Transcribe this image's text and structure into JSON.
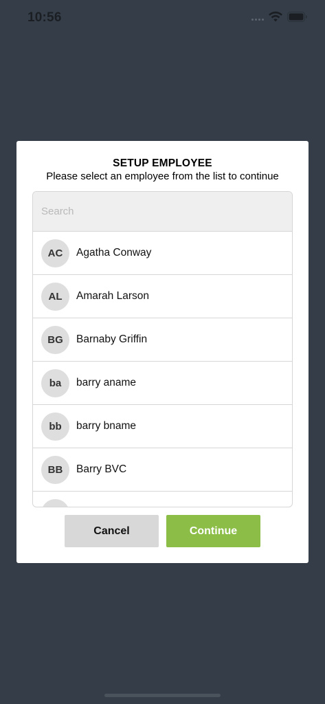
{
  "status_bar": {
    "time": "10:56"
  },
  "dialog": {
    "title": "SETUP EMPLOYEE",
    "subtitle": "Please select an employee from the list to continue",
    "search": {
      "placeholder": "Search",
      "value": ""
    },
    "employees": [
      {
        "initials": "AC",
        "name": "Agatha Conway"
      },
      {
        "initials": "AL",
        "name": "Amarah Larson"
      },
      {
        "initials": "BG",
        "name": "Barnaby Griffin"
      },
      {
        "initials": "ba",
        "name": "barry aname"
      },
      {
        "initials": "bb",
        "name": "barry bname"
      },
      {
        "initials": "BB",
        "name": "Barry BVC"
      },
      {
        "initials": "",
        "name": ""
      }
    ],
    "cancel_label": "Cancel",
    "continue_label": "Continue"
  },
  "colors": {
    "backdrop": "#353e48",
    "continue_button": "#8bbd47",
    "cancel_button": "#d8d8d8",
    "avatar": "#dedede"
  },
  "icons": [
    "wifi-icon",
    "battery-icon",
    "signal-dots-icon"
  ]
}
